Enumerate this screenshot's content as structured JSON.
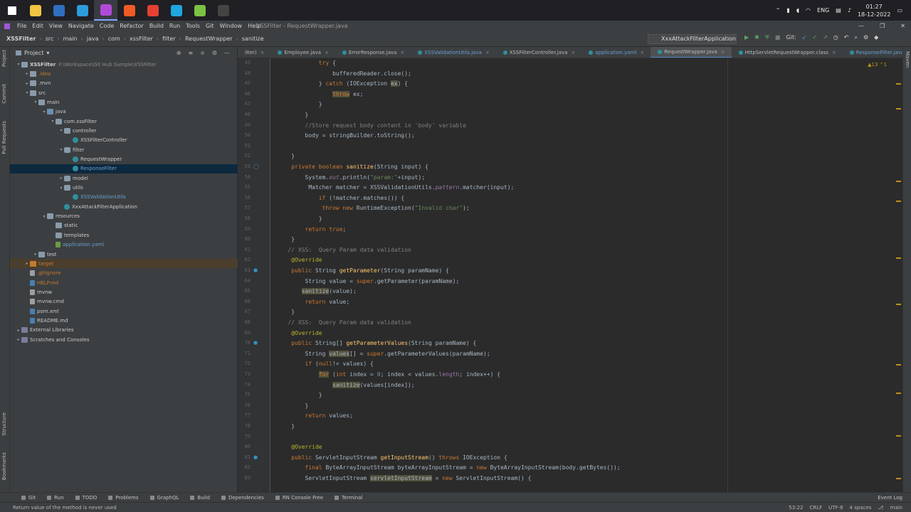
{
  "taskbar": {
    "apps": [
      {
        "name": "windows-start-icon",
        "color": "#ffffff"
      },
      {
        "name": "file-explorer-icon",
        "color": "#f4c542"
      },
      {
        "name": "powershell-icon",
        "color": "#2f6fbf"
      },
      {
        "name": "vscode-icon",
        "color": "#2d9cdb"
      },
      {
        "name": "intellij-icon",
        "color": "#b14ad8"
      },
      {
        "name": "postman-icon",
        "color": "#ef5b25"
      },
      {
        "name": "chrome-icon",
        "color": "#e44134"
      },
      {
        "name": "edge-icon",
        "color": "#1fa8df"
      },
      {
        "name": "notepadpp-icon",
        "color": "#7cc242"
      },
      {
        "name": "terminal-icon",
        "color": "#444444"
      }
    ],
    "language": "ENG",
    "time": "01:27",
    "date": "18-12-2022"
  },
  "menubar": {
    "items": [
      "File",
      "Edit",
      "View",
      "Navigate",
      "Code",
      "Refactor",
      "Build",
      "Run",
      "Tools",
      "Git",
      "Window",
      "Help"
    ],
    "window_title": "XSSFilter - RequestWrapper.java"
  },
  "navbar": {
    "crumbs": [
      "XSSFilter",
      "src",
      "main",
      "java",
      "com",
      "xssFilter",
      "filter",
      "RequestWrapper",
      "sanitize"
    ],
    "run_config": "XxxAttackFilterApplication",
    "git_label": "Git:"
  },
  "project": {
    "header": "Project",
    "tree": [
      {
        "label": "XSSFilter",
        "path": "F:\\Workspace\\Git Hub Sample\\XSSFilter",
        "depth": 0,
        "open": true,
        "icon": "folder",
        "color": "#d0d0d0",
        "bold": true
      },
      {
        "label": ".idea",
        "depth": 1,
        "open": false,
        "icon": "folder",
        "color": "#c37a2f"
      },
      {
        "label": ".mvn",
        "depth": 1,
        "open": false,
        "icon": "folder",
        "color": "#c9c9c9"
      },
      {
        "label": "src",
        "depth": 1,
        "open": true,
        "icon": "folder",
        "color": "#c9c9c9"
      },
      {
        "label": "main",
        "depth": 2,
        "open": true,
        "icon": "folder",
        "color": "#c9c9c9"
      },
      {
        "label": "java",
        "depth": 3,
        "open": true,
        "icon": "src",
        "color": "#c9c9c9"
      },
      {
        "label": "com.xssFilter",
        "depth": 4,
        "open": true,
        "icon": "pkg",
        "color": "#c9c9c9"
      },
      {
        "label": "controller",
        "depth": 5,
        "open": true,
        "icon": "pkg",
        "color": "#c9c9c9"
      },
      {
        "label": "XSSFilterController",
        "depth": 6,
        "icon": "class",
        "color": "#c9c9c9"
      },
      {
        "label": "filter",
        "depth": 5,
        "open": true,
        "icon": "pkg",
        "color": "#c9c9c9"
      },
      {
        "label": "RequestWrapper",
        "depth": 6,
        "icon": "class",
        "color": "#c9c9c9"
      },
      {
        "label": "ResponseFilter",
        "depth": 6,
        "icon": "class",
        "color": "#6a9fd4",
        "selected": true
      },
      {
        "label": "model",
        "depth": 5,
        "open": false,
        "icon": "pkg",
        "color": "#c9c9c9"
      },
      {
        "label": "utils",
        "depth": 5,
        "open": true,
        "icon": "pkg",
        "color": "#c9c9c9"
      },
      {
        "label": "XSSValidationUtils",
        "depth": 6,
        "icon": "class",
        "color": "#6a9fd4"
      },
      {
        "label": "XxxAttackFilterApplication",
        "depth": 5,
        "icon": "class",
        "color": "#c9c9c9"
      },
      {
        "label": "resources",
        "depth": 3,
        "open": true,
        "icon": "folder",
        "color": "#c9c9c9"
      },
      {
        "label": "static",
        "depth": 4,
        "icon": "folder",
        "color": "#c9c9c9"
      },
      {
        "label": "templates",
        "depth": 4,
        "icon": "folder",
        "color": "#c9c9c9"
      },
      {
        "label": "application.yaml",
        "depth": 4,
        "icon": "yaml",
        "color": "#6a9fd4"
      },
      {
        "label": "test",
        "depth": 2,
        "open": false,
        "icon": "folder",
        "color": "#c9c9c9"
      },
      {
        "label": "target",
        "depth": 1,
        "open": false,
        "icon": "orange",
        "color": "#c37a2f",
        "highlight": true
      },
      {
        "label": ".gitignore",
        "depth": 1,
        "icon": "file",
        "color": "#c37a2f"
      },
      {
        "label": "HELP.md",
        "depth": 1,
        "icon": "md",
        "color": "#c37a2f"
      },
      {
        "label": "mvnw",
        "depth": 1,
        "icon": "file",
        "color": "#c9c9c9"
      },
      {
        "label": "mvnw.cmd",
        "depth": 1,
        "icon": "file",
        "color": "#c9c9c9"
      },
      {
        "label": "pom.xml",
        "depth": 1,
        "icon": "md",
        "color": "#c9c9c9"
      },
      {
        "label": "README.md",
        "depth": 1,
        "icon": "md",
        "color": "#c9c9c9"
      },
      {
        "label": "External Libraries",
        "depth": 0,
        "open": false,
        "icon": "lib",
        "color": "#c9c9c9"
      },
      {
        "label": "Scratches and Consoles",
        "depth": 0,
        "open": false,
        "icon": "lib",
        "color": "#c9c9c9"
      }
    ]
  },
  "tabs": [
    {
      "label": "ilter)",
      "active": false
    },
    {
      "label": "Employee.java",
      "active": false
    },
    {
      "label": "ErrorResponse.java",
      "active": false
    },
    {
      "label": "XSSValidationUtils.java",
      "active": false,
      "color": "#6a9fd4"
    },
    {
      "label": "XSSFilterController.java",
      "active": false
    },
    {
      "label": "application.yaml",
      "active": false,
      "color": "#6a9fd4"
    },
    {
      "label": "RequestWrapper.java",
      "active": true
    },
    {
      "label": "HttpServletRequestWrapper.class",
      "active": false
    },
    {
      "label": "ResponseFilter.java",
      "active": false,
      "color": "#6a9fd4"
    }
  ],
  "editor": {
    "inspection": "▲13 ⌃1",
    "lines": [
      {
        "n": "43",
        "html": "            <span class='kw'>try</span> {"
      },
      {
        "n": "44",
        "html": "                bufferedReader.close();"
      },
      {
        "n": "45",
        "html": "            } <span class='kw'>catch</span> (IOException <span class='warn-bg'>ex</span>) {"
      },
      {
        "n": "46",
        "html": "                <span class='kw warn-bg'>throw</span> ex;"
      },
      {
        "n": "47",
        "html": "            }"
      },
      {
        "n": "48",
        "html": "        }"
      },
      {
        "n": "49",
        "html": "        <span class='cm'>//Store request body content in 'body' variable</span>"
      },
      {
        "n": "50",
        "html": "        body = stringBuilder.toString();"
      },
      {
        "n": "51",
        "html": ""
      },
      {
        "n": "52",
        "html": "    }"
      },
      {
        "n": "53",
        "html": "    <span class='kw'>private boolean</span> <span class='fn'>sanitize</span>(String input) {",
        "mark": "◯"
      },
      {
        "n": "54",
        "html": "        System.<span class='fld it'>out</span>.println(<span class='str'>\"param:\"</span>+input);"
      },
      {
        "n": "55",
        "html": "         Matcher matcher = XSSValidationUtils.<span class='fld it'>pattern</span>.matcher(input);"
      },
      {
        "n": "56",
        "html": "            <span class='kw'>if</span> (!matcher.matches()) {"
      },
      {
        "n": "57",
        "html": "             <span class='kw'>throw new</span> RuntimeException(<span class='str'>\"Invalid char\"</span>);"
      },
      {
        "n": "58",
        "html": "            }"
      },
      {
        "n": "59",
        "html": "        <span class='kw'>return true</span>;"
      },
      {
        "n": "60",
        "html": "    }"
      },
      {
        "n": "61",
        "html": "   <span class='cm'>// XSS:  Query Param data validation</span>"
      },
      {
        "n": "62",
        "html": "    <span class='an'>@Override</span>"
      },
      {
        "n": "63",
        "html": "    <span class='kw'>public</span> String <span class='fn'>getParameter</span>(String paramName) {",
        "mark": "●"
      },
      {
        "n": "64",
        "html": "        String value = <span class='kw'>super</span>.getParameter(paramName);"
      },
      {
        "n": "65",
        "html": "       <span class='warn-bg'>sanitize</span>(value);"
      },
      {
        "n": "66",
        "html": "        <span class='kw'>return</span> value;"
      },
      {
        "n": "67",
        "html": "    }"
      },
      {
        "n": "68",
        "html": "   <span class='cm'>// XSS:  Query Param data validation</span>"
      },
      {
        "n": "69",
        "html": "    <span class='an'>@Override</span>"
      },
      {
        "n": "70",
        "html": "    <span class='kw'>public</span> String[] <span class='fn'>getParameterValues</span>(String paramName) {",
        "mark": "●"
      },
      {
        "n": "71",
        "html": "        String <span class='warn-bg'>values</span>[] = <span class='kw'>super</span>.getParameterValues(paramName);"
      },
      {
        "n": "72",
        "html": "        <span class='kw'>if</span> (<span class='kw'>null</span>!= values) {"
      },
      {
        "n": "73",
        "html": "            <span class='kw warn-bg'>for</span> (<span class='kw'>int</span> index = <span class='num'>0</span>; index &lt; values.<span class='fld'>length</span>; index++) {"
      },
      {
        "n": "74",
        "html": "                <span class='warn-bg'>sanitize</span>(values[index]);"
      },
      {
        "n": "75",
        "html": "            }"
      },
      {
        "n": "76",
        "html": "        }"
      },
      {
        "n": "77",
        "html": "        <span class='kw'>return</span> values;"
      },
      {
        "n": "78",
        "html": "    }"
      },
      {
        "n": "79",
        "html": ""
      },
      {
        "n": "80",
        "html": "    <span class='an'>@Override</span>"
      },
      {
        "n": "81",
        "html": "    <span class='kw'>public</span> ServletInputStream <span class='fn'>getInputStream</span>() <span class='kw'>throws</span> IOException {",
        "mark": "●"
      },
      {
        "n": "82",
        "html": "        <span class='kw'>final</span> ByteArrayInputStream byteArrayInputStream = <span class='kw'>new</span> ByteArrayInputStream(body.getBytes());"
      },
      {
        "n": "83",
        "html": "        ServletInputStream <span class='warn-bg'>servletInputStream</span> = <span class='kw'>new</span> ServletInputStream() {"
      }
    ]
  },
  "bottombar": {
    "tools": [
      "Git",
      "Run",
      "TODO",
      "Problems",
      "GraphQL",
      "Build",
      "Dependencies",
      "RN Console Free",
      "Terminal"
    ],
    "event_log": "Event Log"
  },
  "statusbar": {
    "message": "Return value of the method is never used",
    "position": "53:22",
    "line_sep": "CRLF",
    "encoding": "UTF-8",
    "indent": "4 spaces",
    "branch": "main"
  }
}
